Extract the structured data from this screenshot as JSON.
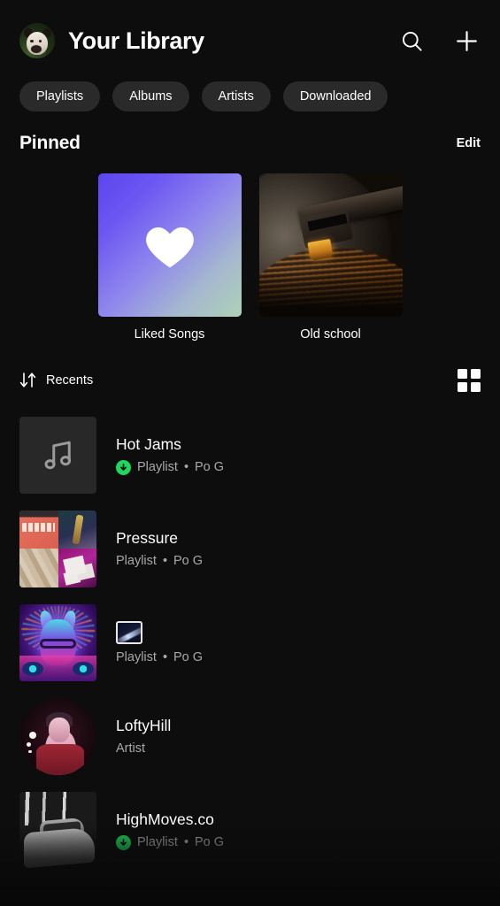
{
  "header": {
    "title": "Your Library",
    "avatar_name": "user-avatar-bulldog",
    "search_icon": "search-icon",
    "add_icon": "plus-icon"
  },
  "filters": [
    {
      "label": "Playlists"
    },
    {
      "label": "Albums"
    },
    {
      "label": "Artists"
    },
    {
      "label": "Downloaded"
    }
  ],
  "pinned": {
    "title": "Pinned",
    "edit_label": "Edit",
    "items": [
      {
        "label": "Liked Songs",
        "art": "liked-songs-gradient-heart"
      },
      {
        "label": "Old school",
        "art": "turntable-photo"
      }
    ]
  },
  "recents": {
    "sort_label": "Recents",
    "sort_icon": "sort-arrows-icon",
    "view_icon": "grid-view-icon",
    "items": [
      {
        "title": "Hot Jams",
        "type": "Playlist",
        "separator": "•",
        "owner": "Po G",
        "downloaded": true,
        "art": "music-note-placeholder",
        "shape": "square"
      },
      {
        "title": "Pressure",
        "type": "Playlist",
        "separator": "•",
        "owner": "Po G",
        "downloaded": false,
        "art": "four-tile-collage",
        "shape": "square"
      },
      {
        "title": "",
        "title_is_emoji": true,
        "type": "Playlist",
        "separator": "•",
        "owner": "Po G",
        "downloaded": false,
        "art": "neon-dj-dog",
        "shape": "square"
      },
      {
        "title": "LoftyHill",
        "type": "Artist",
        "separator": "",
        "owner": "",
        "downloaded": false,
        "art": "artist-photo",
        "shape": "circle"
      },
      {
        "title": "HighMoves.co",
        "type": "Playlist",
        "separator": "•",
        "owner": "Po G",
        "downloaded": true,
        "art": "car-photo-bw",
        "shape": "square"
      }
    ]
  },
  "colors": {
    "background": "#0d0d0d",
    "chip": "#2a2a2a",
    "accent_green": "#1ed760",
    "subtext": "#a8a8a8",
    "liked_gradient_start": "#5b45f0",
    "liked_gradient_end": "#aed2b6"
  }
}
